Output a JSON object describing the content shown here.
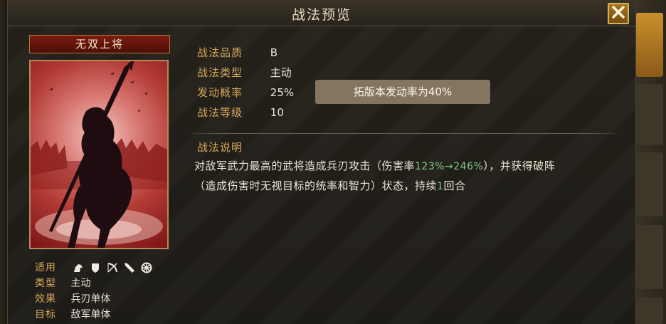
{
  "window": {
    "title": "战法预览"
  },
  "card": {
    "name": "无双上将"
  },
  "info": {
    "apply_label": "适用",
    "apply_icons": [
      "horse-icon",
      "shield-icon",
      "bow-icon",
      "spear-icon",
      "wheel-icon"
    ],
    "type_label": "类型",
    "type_value": "主动",
    "effect_label": "效果",
    "effect_value": "兵刃单体",
    "target_label": "目标",
    "target_value": "敌军单体"
  },
  "attributes": [
    {
      "label": "战法品质",
      "value": "B"
    },
    {
      "label": "战法类型",
      "value": "主动"
    },
    {
      "label": "发动概率",
      "value": "25%"
    },
    {
      "label": "战法等级",
      "value": "10"
    }
  ],
  "notice": "拓版本发动率为40%",
  "description": {
    "title": "战法说明",
    "line1_before": "对敌军武力最高的武将造成兵刃攻击（伤害率",
    "line1_highlight": "123%→246%",
    "line1_after": "），并获得破阵",
    "line2_before": "（造成伤害时无视目标的统率和智力）状态，持续",
    "line2_highlight": "1",
    "line2_after": "回合"
  },
  "colors": {
    "accent_gold": "#d6a85a",
    "highlight_green": "#7ec98a",
    "notice_bg": "#857560",
    "card_red": "#b23a34"
  }
}
